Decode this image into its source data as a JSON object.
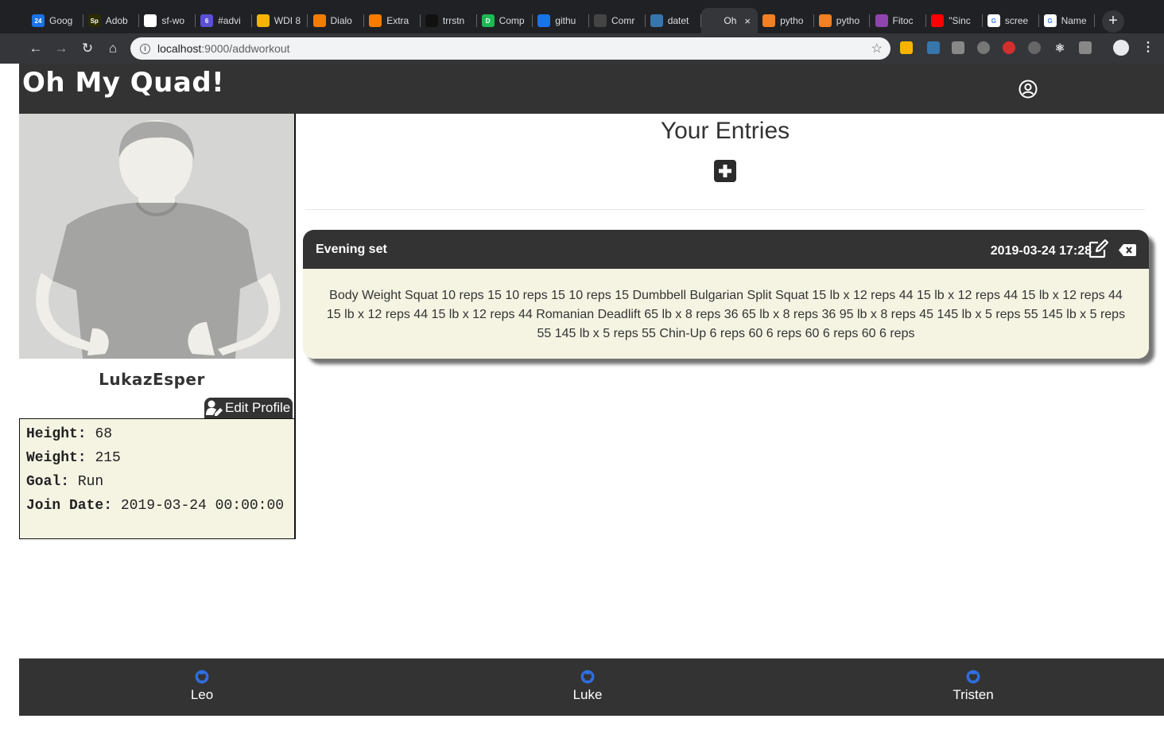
{
  "browser": {
    "tabs": [
      {
        "label": "Goog",
        "fav": "24",
        "color": "#1a73e8"
      },
      {
        "label": "Adob",
        "fav": "Sp",
        "color": "#2b2b00"
      },
      {
        "label": "sf-wo",
        "fav": "",
        "color": "#ffffff"
      },
      {
        "label": "#advi",
        "fav": "6",
        "color": "#5b4fd6"
      },
      {
        "label": "WDI 8",
        "fav": "",
        "color": "#f6b400"
      },
      {
        "label": "Dialo",
        "fav": "",
        "color": "#f57c00"
      },
      {
        "label": "Extra",
        "fav": "",
        "color": "#f57c00"
      },
      {
        "label": "trrstn",
        "fav": "",
        "color": "#111111"
      },
      {
        "label": "Comp",
        "fav": "D",
        "color": "#1db954"
      },
      {
        "label": "githu",
        "fav": "",
        "color": "#1a73e8"
      },
      {
        "label": "Comr",
        "fav": "",
        "color": "#444444"
      },
      {
        "label": "datet",
        "fav": "",
        "color": "#3776ab"
      },
      {
        "label": "Oh",
        "fav": "",
        "color": "#35363a"
      },
      {
        "label": "pytho",
        "fav": "",
        "color": "#f48024"
      },
      {
        "label": "pytho",
        "fav": "",
        "color": "#f48024"
      },
      {
        "label": "Fitoc",
        "fav": "",
        "color": "#8e44ad"
      },
      {
        "label": "\"Sinc",
        "fav": "",
        "color": "#ff0000"
      },
      {
        "label": "scree",
        "fav": "G",
        "color": "#ffffff"
      },
      {
        "label": "Name",
        "fav": "G",
        "color": "#ffffff"
      }
    ],
    "active_tab_index": 12,
    "url_host": "localhost",
    "url_path": ":9000/addworkout"
  },
  "header": {
    "brand": "Oh My Quad!"
  },
  "profile": {
    "username": "LukazEsper",
    "edit_label": "Edit Profile",
    "stats": [
      {
        "label": "Height:",
        "value": "68"
      },
      {
        "label": "Weight:",
        "value": "215"
      },
      {
        "label": "Goal:",
        "value": "Run"
      },
      {
        "label": "Join Date:",
        "value": "2019-03-24 00:00:00"
      }
    ]
  },
  "main": {
    "title": "Your Entries",
    "entries": [
      {
        "title": "Evening set",
        "date": "2019-03-24 17:28",
        "body": "Body Weight Squat 10 reps 15 10 reps 15 10 reps 15 Dumbbell Bulgarian Split Squat 15 lb x 12 reps 44 15 lb x 12 reps 44 15 lb x 12 reps 44 15 lb x 12 reps 44 15 lb x 12 reps 44 Romanian Deadlift 65 lb x 8 reps 36 65 lb x 8 reps 36 95 lb x 8 reps 45 145 lb x 5 reps 55 145 lb x 5 reps 55 145 lb x 5 reps 55 Chin-Up 6 reps 60 6 reps 60 6 reps 60 6 reps"
      }
    ]
  },
  "footer": {
    "links": [
      {
        "label": "Leo"
      },
      {
        "label": "Luke"
      },
      {
        "label": "Tristen"
      }
    ]
  }
}
